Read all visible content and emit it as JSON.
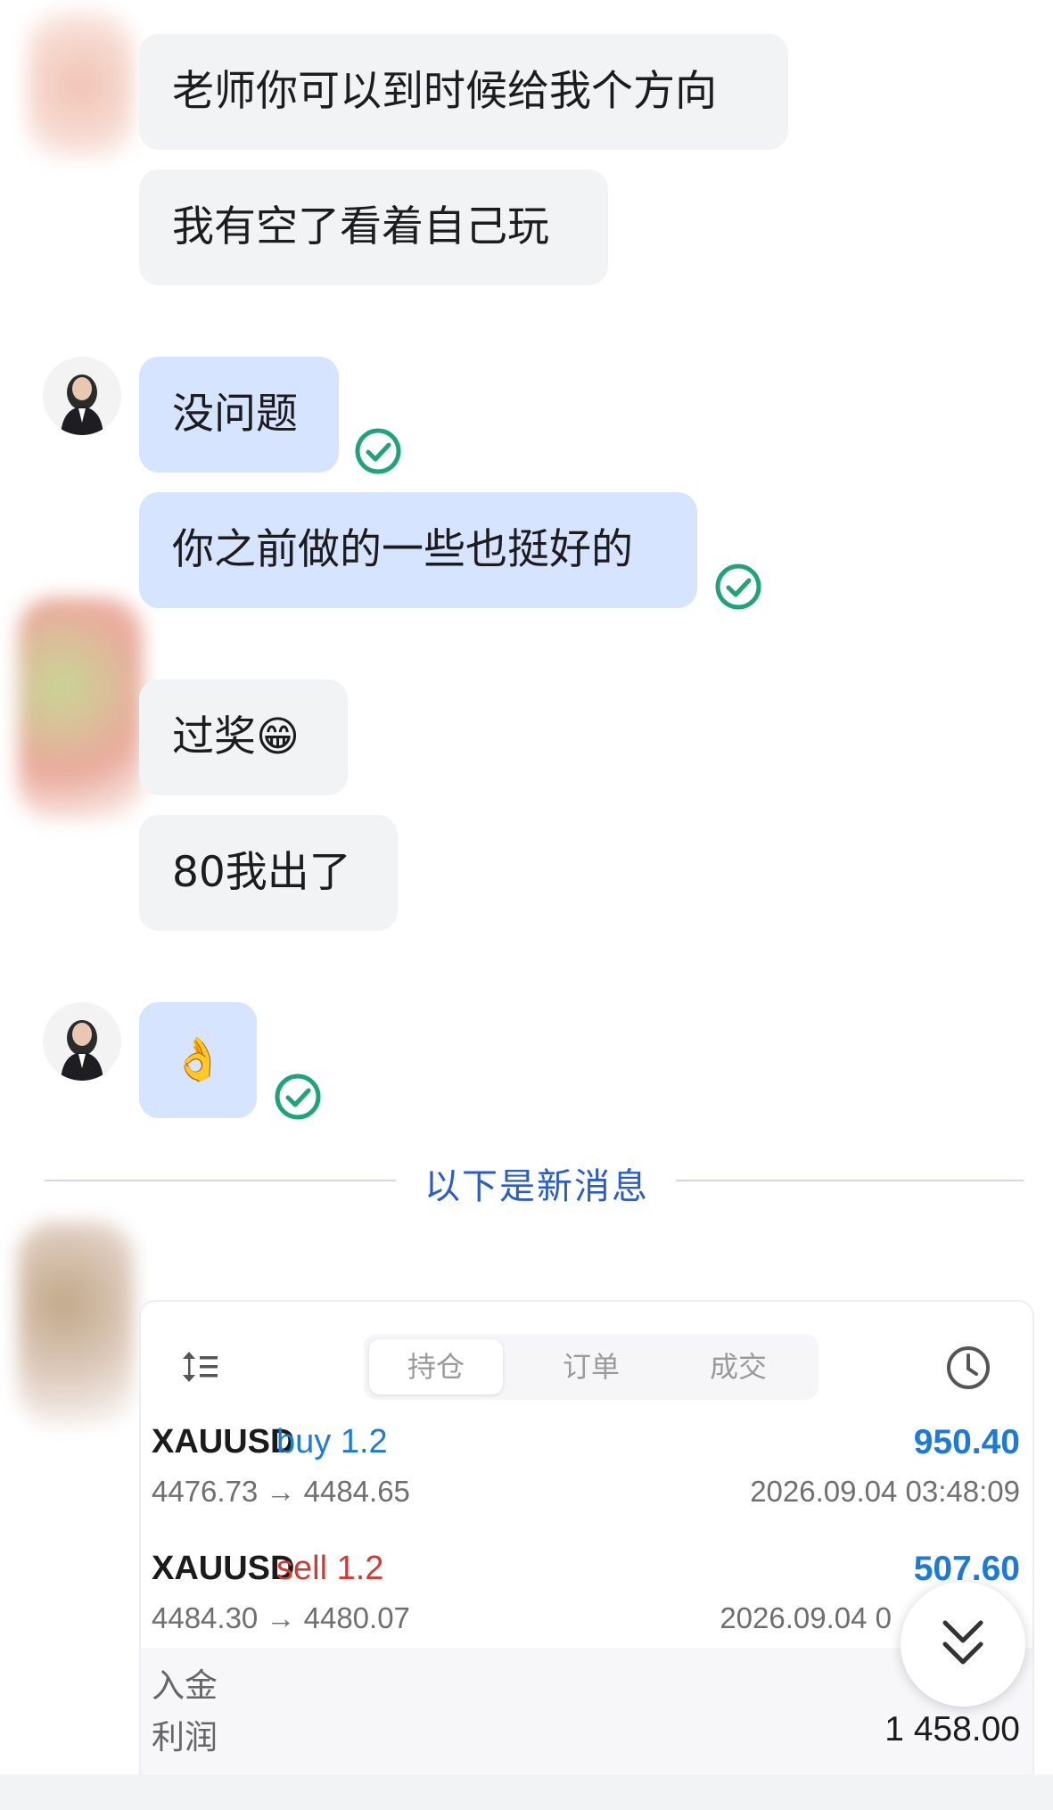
{
  "messages": [
    {
      "id": "m1",
      "text": "老师你可以到时候给我个方向"
    },
    {
      "id": "m2",
      "text": "我有空了看着自己玩"
    },
    {
      "id": "m3",
      "text": "没问题"
    },
    {
      "id": "m4",
      "text": "你之前做的一些也挺好的"
    },
    {
      "id": "m5",
      "text": "过奖😁"
    },
    {
      "id": "m6",
      "text": "80我出了"
    },
    {
      "id": "m7",
      "text": "👌"
    }
  ],
  "divider": {
    "text": "以下是新消息"
  },
  "card": {
    "tabs": [
      "持仓",
      "订单",
      "成交"
    ],
    "active_tab": "持仓",
    "trades": [
      {
        "symbol": "XAUUSD",
        "side": "buy 1.2",
        "side_color": "#1e7bd4",
        "profit": "950.40",
        "prices": "4476.73 → 4484.65",
        "time": "2026.09.04 03:48:09"
      },
      {
        "symbol": "XAUUSD",
        "side": "sell 1.2",
        "side_color": "#d23b32",
        "profit": "507.60",
        "prices": "4484.30 → 4480.07",
        "time": "2026.09.04 0"
      }
    ],
    "summary": [
      {
        "label": "入金",
        "value": ""
      },
      {
        "label": "利润",
        "value": "1 458.00"
      }
    ]
  },
  "colors": {
    "incoming": "#f2f3f5",
    "outgoing": "#d6e4ff",
    "check": "#1fa37a",
    "accent": "#2c5cc5"
  },
  "icons": {
    "read": "check-circle-icon",
    "sort": "sort-icon",
    "history": "clock-icon",
    "scroll": "double-chevron-down-icon"
  }
}
